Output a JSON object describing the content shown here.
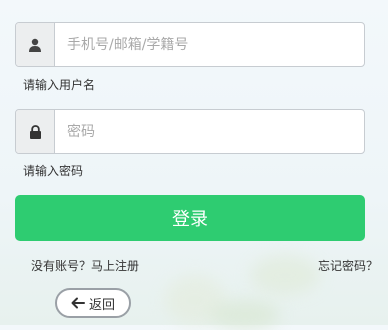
{
  "login_form": {
    "username": {
      "placeholder": "手机号/邮箱/学籍号",
      "value": "",
      "hint": "请输入用户名",
      "icon": "user-icon"
    },
    "password": {
      "placeholder": "密码",
      "value": "",
      "hint": "请输入密码",
      "icon": "lock-icon"
    },
    "submit_label": "登录",
    "register_link": "没有账号？马上注册",
    "forgot_link": "忘记密码？",
    "back_label": "返回",
    "back_icon": "arrow-left-icon"
  },
  "colors": {
    "accent": "#2ecc71",
    "addon_bg": "#eceeef",
    "border": "#c7ccd1"
  }
}
